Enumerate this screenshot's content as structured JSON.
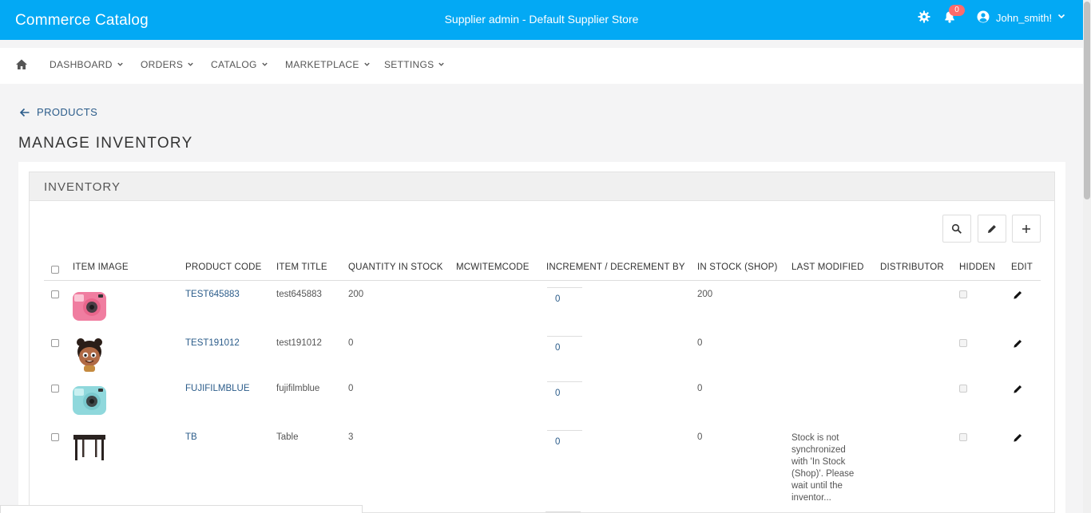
{
  "header": {
    "brand": "Commerce Catalog",
    "store_title": "Supplier admin - Default Supplier Store",
    "notifications_count": "0",
    "user_name": "John_smith!",
    "accent_color": "#03a9f4"
  },
  "nav": {
    "items": [
      {
        "label": "DASHBOARD"
      },
      {
        "label": "ORDERS"
      },
      {
        "label": "CATALOG"
      },
      {
        "label": "MARKETPLACE"
      },
      {
        "label": "SETTINGS"
      }
    ]
  },
  "page": {
    "back_label": "PRODUCTS",
    "title": "MANAGE INVENTORY"
  },
  "panel": {
    "title": "INVENTORY",
    "tools": [
      "search-icon",
      "pencil-icon",
      "plus-icon"
    ]
  },
  "table": {
    "headers": {
      "image": "ITEM IMAGE",
      "code": "PRODUCT CODE",
      "title": "ITEM TITLE",
      "qty": "QUANTITY IN STOCK",
      "mcw": "MCWITEMCODE",
      "inc": "INCREMENT / DECREMENT BY",
      "shop": "IN STOCK (SHOP)",
      "modified": "LAST MODIFIED",
      "distributor": "DISTRIBUTOR",
      "hidden": "HIDDEN",
      "edit": "EDIT"
    },
    "rows": [
      {
        "image": "pink-instant-camera",
        "code": "TEST645883",
        "title": "test645883",
        "qty": "200",
        "mcw": "",
        "inc": "0",
        "shop": "200",
        "modified": "",
        "distributor": ""
      },
      {
        "image": "cartoon-character",
        "code": "TEST191012",
        "title": "test191012",
        "qty": "0",
        "mcw": "",
        "inc": "0",
        "shop": "0",
        "modified": "",
        "distributor": ""
      },
      {
        "image": "blue-instant-camera",
        "code": "FUJIFILMBLUE",
        "title": "fujifilmblue",
        "qty": "0",
        "mcw": "",
        "inc": "0",
        "shop": "0",
        "modified": "",
        "distributor": ""
      },
      {
        "image": "table",
        "code": "TB",
        "title": "Table",
        "qty": "3",
        "mcw": "",
        "inc": "0",
        "shop": "0",
        "modified": "Stock is not synchronized with 'In Stock (Shop)'. Please wait until the inventor...",
        "distributor": ""
      }
    ]
  }
}
